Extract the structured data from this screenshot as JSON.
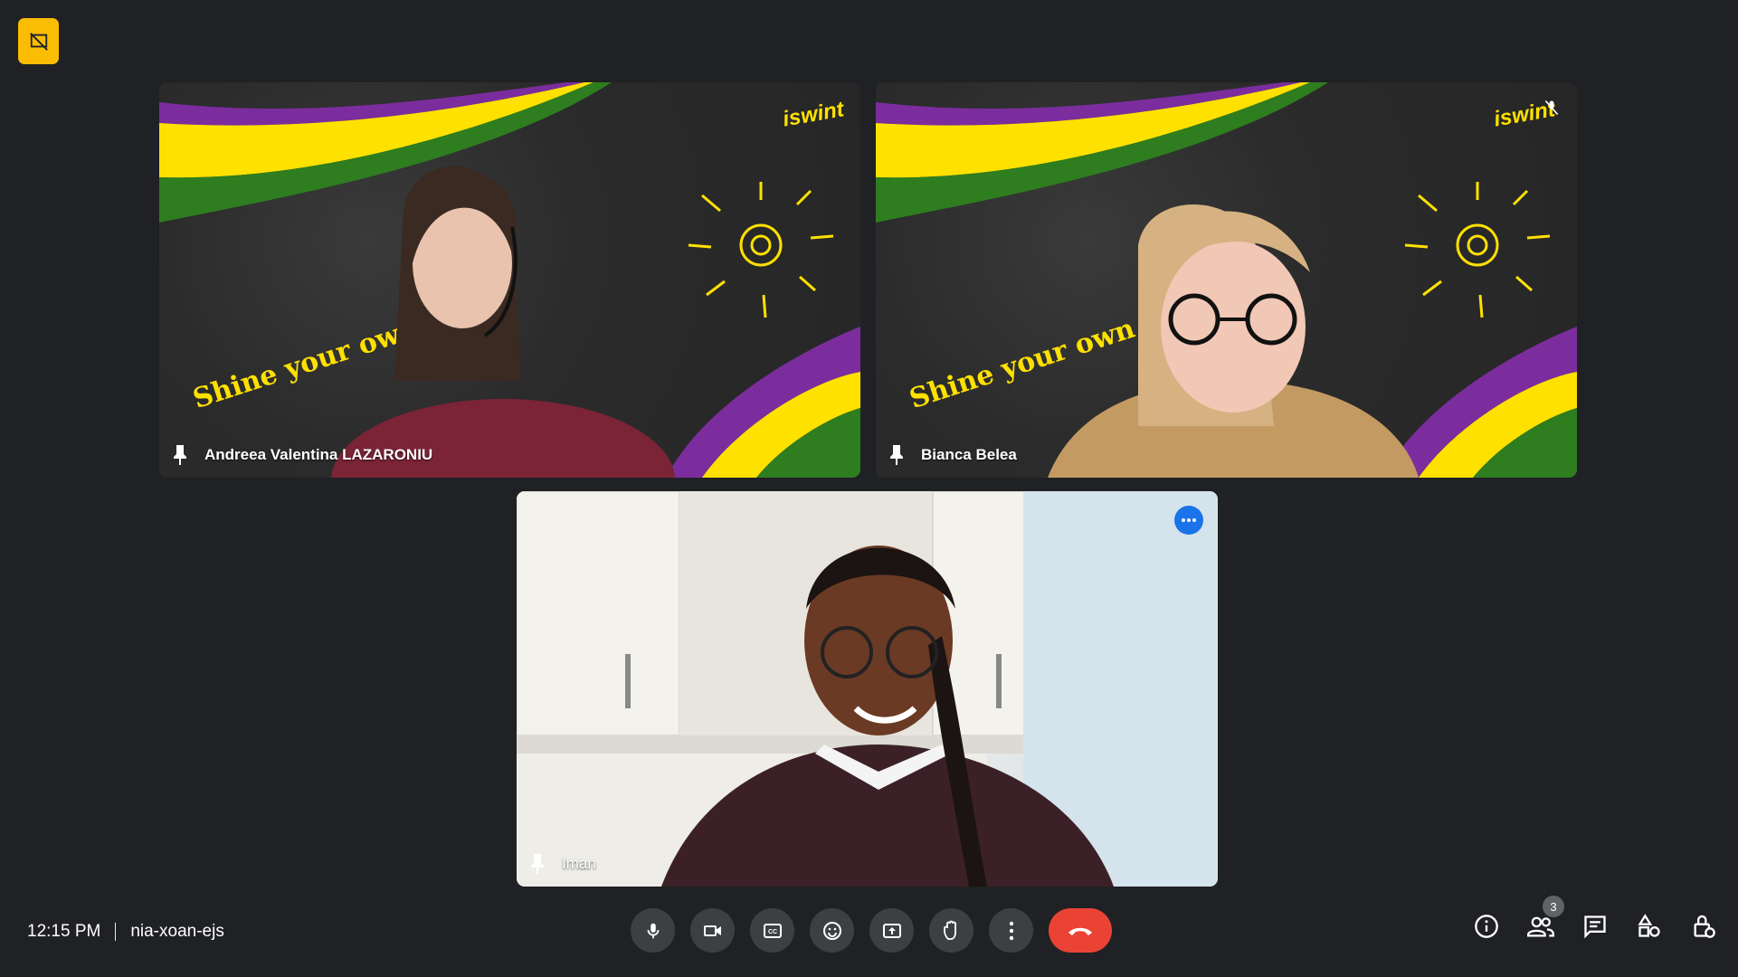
{
  "participants": [
    {
      "name": "Andreea Valentina LAZARONIU",
      "background_text": "Shine your own light",
      "logo_text": "iswint"
    },
    {
      "name": "Bianca Belea",
      "background_text": "Shine your own light",
      "logo_text": "iswint"
    },
    {
      "name": "Iman"
    }
  ],
  "meeting": {
    "time": "12:15 PM",
    "code": "nia-xoan-ejs"
  },
  "people_count": "3",
  "colors": {
    "background": "#202124",
    "control": "#3c4043",
    "end_call": "#ea4335",
    "badge": "#fbbc04",
    "accent": "#1a73e8",
    "stripe_purple": "#7b2d9e",
    "stripe_yellow": "#ffe100",
    "stripe_green": "#2e7d1f"
  },
  "icons": {
    "top_badge": "presentation-off-icon",
    "controls": [
      "mic-icon",
      "camera-icon",
      "captions-icon",
      "emoji-icon",
      "present-icon",
      "raise-hand-icon",
      "more-options-icon",
      "end-call-icon"
    ],
    "right_controls": [
      "info-icon",
      "people-icon",
      "chat-icon",
      "activities-icon",
      "host-controls-icon"
    ]
  }
}
